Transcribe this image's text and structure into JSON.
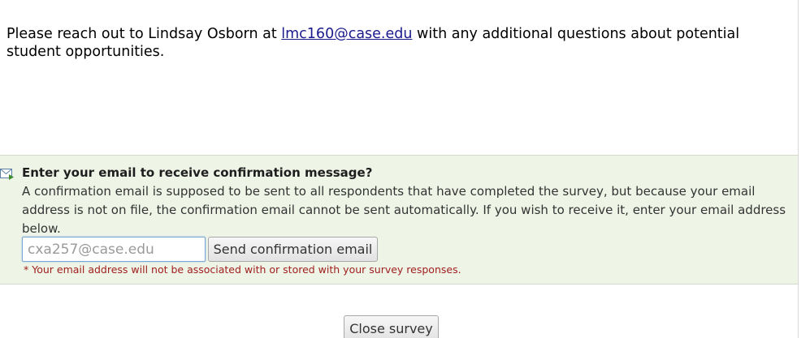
{
  "message": {
    "prefix": "Please reach out to Lindsay Osborn at ",
    "email_link": "lmc160@case.edu",
    "suffix": " with any additional questions about potential student opportunities."
  },
  "confirmation": {
    "icon": "envelope-arrow-icon",
    "title": "Enter your email to receive confirmation message?",
    "description": "A confirmation email is supposed to be sent to all respondents that have completed the survey, but because your email address is not on file, the confirmation email cannot be sent automatically. If you wish to receive it, enter your email address below.",
    "email_placeholder": "cxa257@case.edu",
    "send_label": "Send confirmation email",
    "privacy_note": "* Your email address will not be associated with or stored with your survey responses."
  },
  "footer": {
    "close_label": "Close survey"
  },
  "colors": {
    "panel_background": "#eef4e6",
    "link": "#1a1a8c",
    "note": "#a02020"
  }
}
